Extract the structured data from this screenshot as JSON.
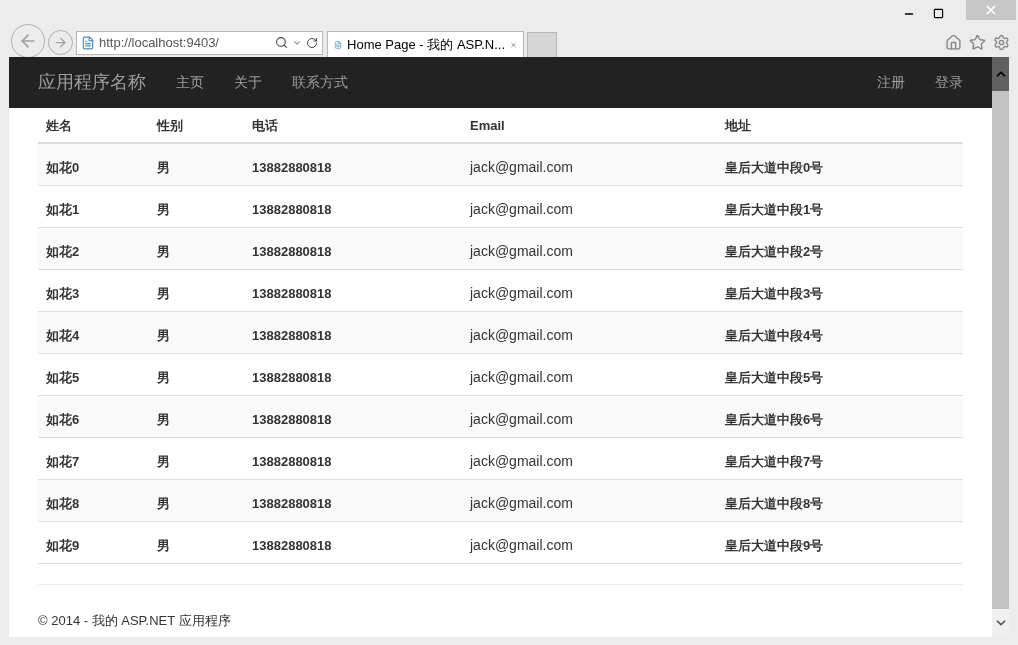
{
  "browser": {
    "address": "http://localhost:9403/",
    "tab_title": "Home Page - 我的 ASP.N..."
  },
  "navbar": {
    "brand": "应用程序名称",
    "links": [
      "主页",
      "关于",
      "联系方式"
    ],
    "right_links": [
      "注册",
      "登录"
    ]
  },
  "table": {
    "columns": [
      "姓名",
      "性别",
      "电话",
      "Email",
      "地址"
    ],
    "rows": [
      [
        "如花0",
        "男",
        "13882880818",
        "jack@gmail.com",
        "皇后大道中段0号"
      ],
      [
        "如花1",
        "男",
        "13882880818",
        "jack@gmail.com",
        "皇后大道中段1号"
      ],
      [
        "如花2",
        "男",
        "13882880818",
        "jack@gmail.com",
        "皇后大道中段2号"
      ],
      [
        "如花3",
        "男",
        "13882880818",
        "jack@gmail.com",
        "皇后大道中段3号"
      ],
      [
        "如花4",
        "男",
        "13882880818",
        "jack@gmail.com",
        "皇后大道中段4号"
      ],
      [
        "如花5",
        "男",
        "13882880818",
        "jack@gmail.com",
        "皇后大道中段5号"
      ],
      [
        "如花6",
        "男",
        "13882880818",
        "jack@gmail.com",
        "皇后大道中段6号"
      ],
      [
        "如花7",
        "男",
        "13882880818",
        "jack@gmail.com",
        "皇后大道中段7号"
      ],
      [
        "如花8",
        "男",
        "13882880818",
        "jack@gmail.com",
        "皇后大道中段8号"
      ],
      [
        "如花9",
        "男",
        "13882880818",
        "jack@gmail.com",
        "皇后大道中段9号"
      ]
    ]
  },
  "footer": "© 2014 - 我的 ASP.NET 应用程序"
}
